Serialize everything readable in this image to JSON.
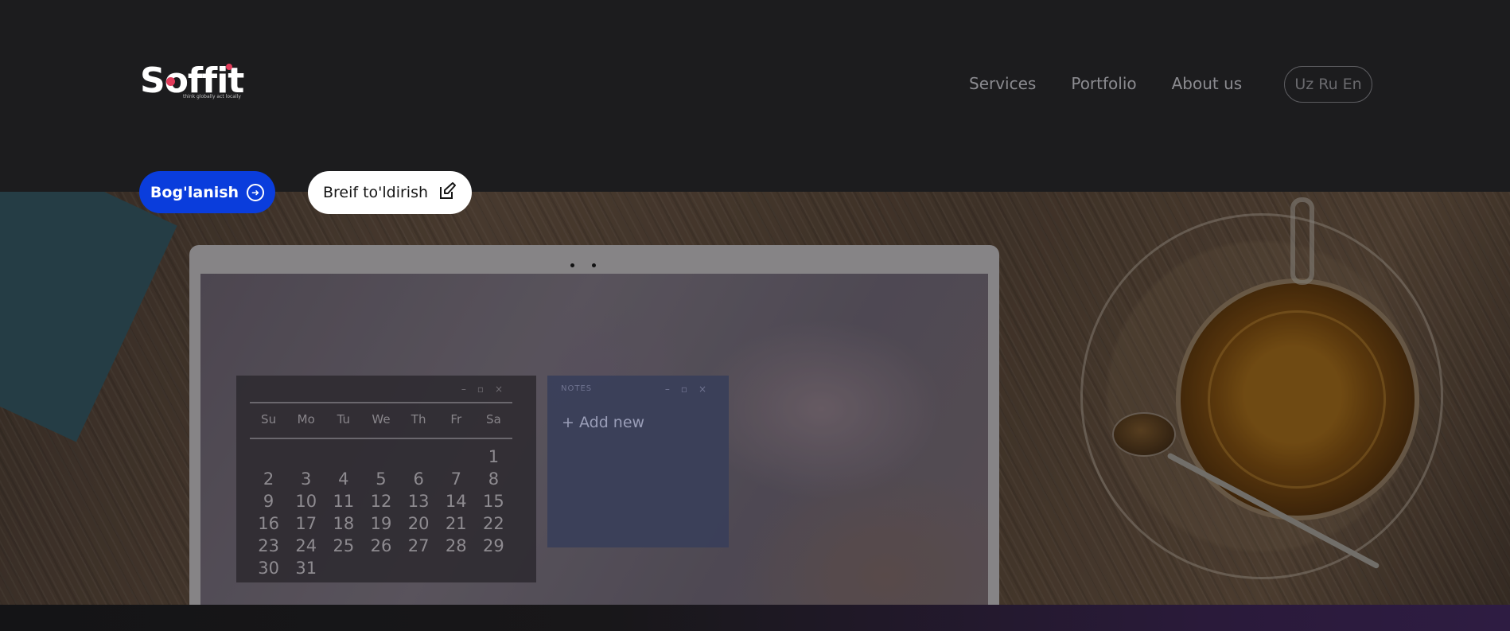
{
  "brand": {
    "name": "Soffit",
    "tagline": "think globally act locally",
    "accent": "#e23b5a"
  },
  "nav": {
    "items": [
      "Services",
      "Portfolio",
      "About us"
    ]
  },
  "languages": [
    "Uz",
    "Ru",
    "En"
  ],
  "actions": {
    "contact_label": "Bog'lanish",
    "contact_icon": "arrow-circle-right-icon",
    "brief_label": "Breif to'ldirish",
    "brief_icon": "edit-icon",
    "contact_color": "#0a3ddc"
  },
  "hero": {
    "calendar": {
      "weekdays": [
        "Su",
        "Mo",
        "Tu",
        "We",
        "Th",
        "Fr",
        "Sa"
      ],
      "days": [
        "1",
        "2",
        "3",
        "4",
        "5",
        "6",
        "7",
        "8",
        "9",
        "10",
        "11",
        "12",
        "13",
        "14",
        "15",
        "16",
        "17",
        "18",
        "19",
        "20",
        "21",
        "22",
        "23",
        "24",
        "25",
        "26",
        "27",
        "28",
        "29",
        "30",
        "31"
      ]
    },
    "notes": {
      "title": "NOTES",
      "add_label": "Add new"
    }
  }
}
